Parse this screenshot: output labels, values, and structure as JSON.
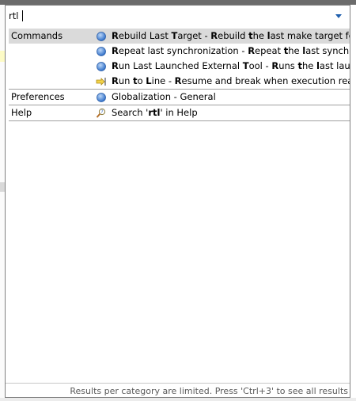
{
  "search": {
    "value": "rtl",
    "placeholder": ""
  },
  "groups": [
    {
      "category": "Commands",
      "items": [
        {
          "icon": "blue-circle-icon",
          "label": "Rebuild Last Target",
          "separator": " - ",
          "description": "Rebuild the last make target for the selected container or project",
          "selected": true
        },
        {
          "icon": "blue-circle-icon",
          "label": "Repeat last synchronization",
          "separator": " - ",
          "description": "Repeat the last synchronization",
          "selected": false
        },
        {
          "icon": "blue-circle-icon",
          "label": "Run Last Launched External Tool",
          "separator": " - ",
          "description": "Runs the last launched External Tool",
          "selected": false
        },
        {
          "icon": "run-to-line-icon",
          "label": "Run to Line",
          "separator": " - ",
          "description": "Resume and break when execution reaches the current line",
          "selected": false
        }
      ]
    },
    {
      "category": "Preferences",
      "items": [
        {
          "icon": "blue-circle-icon",
          "label": "Globalization",
          "separator": " - ",
          "description": "General",
          "selected": false
        }
      ]
    },
    {
      "category": "Help",
      "items": [
        {
          "icon": "help-search-icon",
          "label": "Search 'rtl' in Help",
          "separator": "",
          "description": "",
          "selected": false
        }
      ]
    }
  ],
  "footer": "Results per category are limited. Press 'Ctrl+3' to see all results",
  "colors": {
    "selection": "#dadada",
    "icon_blue": "#3d7fd6",
    "separator": "#a0a0a0"
  }
}
